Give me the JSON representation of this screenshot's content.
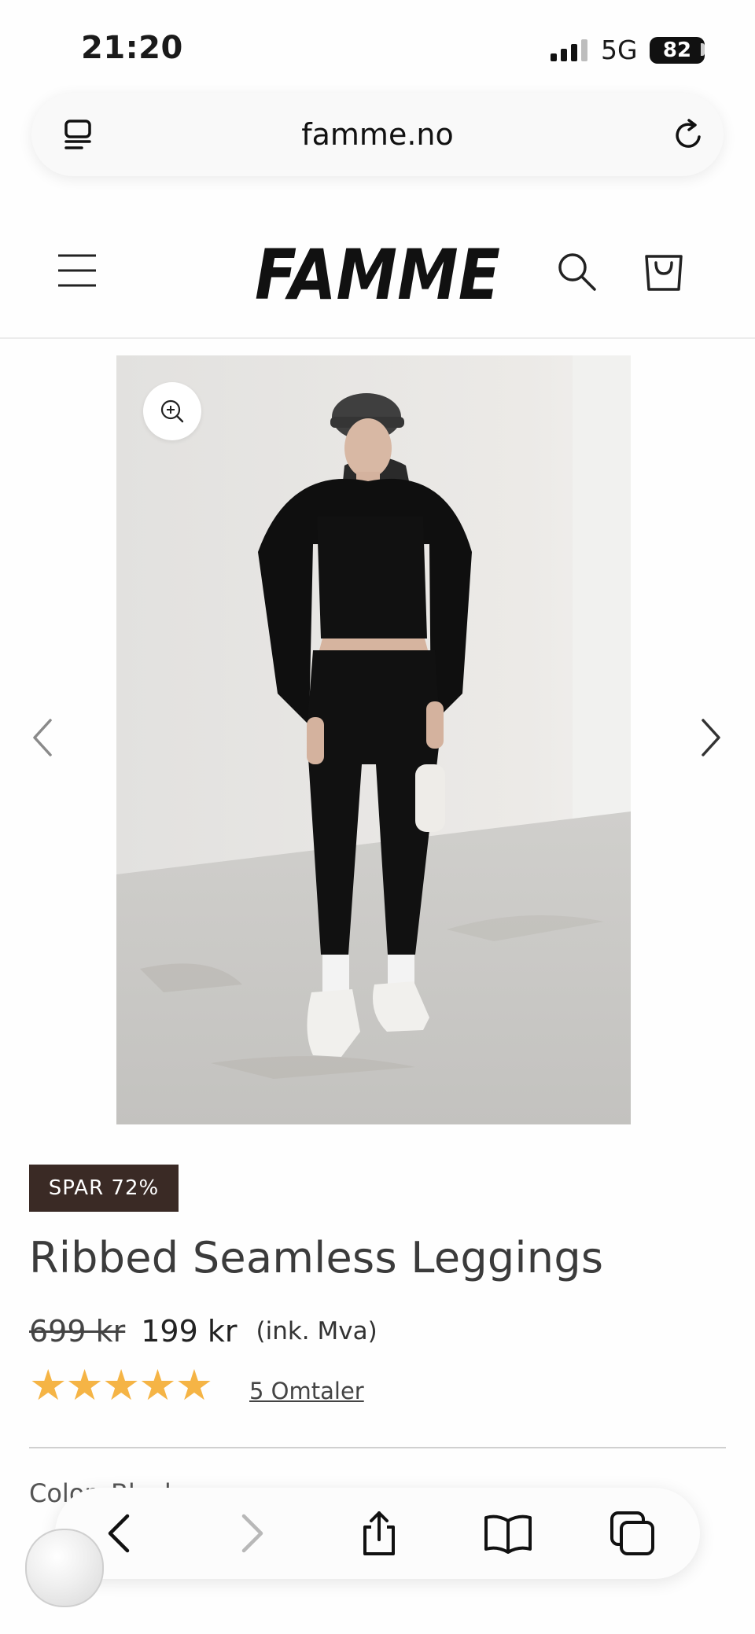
{
  "status_bar": {
    "time": "21:20",
    "network": "5G",
    "battery": "82"
  },
  "browser": {
    "url": "famme.no"
  },
  "site": {
    "logo": "FAMME"
  },
  "product": {
    "badge": "SPAR 72%",
    "title": "Ribbed Seamless Leggings",
    "old_price": "699 kr",
    "price": "199 kr",
    "vat_note": "(ink. Mva)",
    "rating": 5,
    "reviews_label": "5 Omtaler",
    "color_label": "Color: Black"
  },
  "colors": {
    "badge_bg": "#3a2a25",
    "star": "#f5b445",
    "title": "#3b3b3b"
  },
  "icons": [
    "reader-icon",
    "reload-icon",
    "menu-icon",
    "search-icon",
    "cart-icon",
    "zoom-icon",
    "chevron-left-icon",
    "chevron-right-icon",
    "back-icon",
    "forward-icon",
    "share-icon",
    "bookmarks-icon",
    "tabs-icon"
  ]
}
